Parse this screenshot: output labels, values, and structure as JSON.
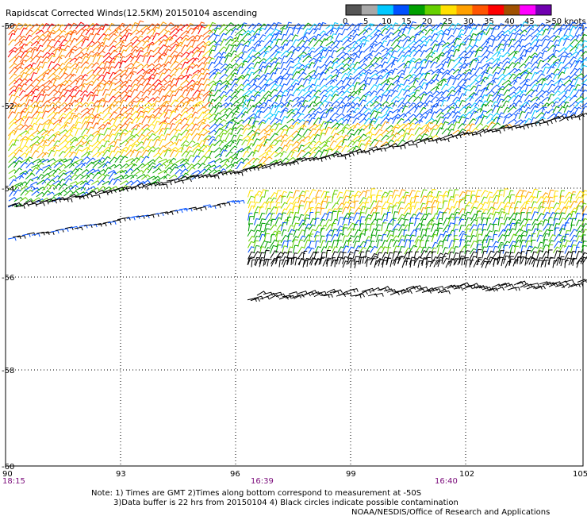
{
  "title": "Rapidscat Corrected Winds(12.5KM) 20150104 ascending",
  "colorbar": {
    "labels": [
      "0",
      "5",
      "10",
      "15",
      "20",
      "25",
      "30",
      "35",
      "40",
      "45",
      ">50 knots"
    ],
    "colors": [
      "#555555",
      "#a8a8a8",
      "#00c8ff",
      "#0050ff",
      "#00a000",
      "#66d000",
      "#ffe000",
      "#ffa000",
      "#ff5500",
      "#ff0000",
      "#a05000",
      "#ff00ff",
      "#7000b0"
    ]
  },
  "map": {
    "lat_labels": [
      "-50",
      "-52",
      "-54",
      "-56",
      "-58",
      "-60"
    ],
    "lon_labels": [
      "90",
      "93",
      "96",
      "99",
      "102",
      "105"
    ],
    "times": [
      "18:15",
      "16:39",
      "16:40"
    ]
  },
  "notes": {
    "line1": "Note: 1) Times are GMT 2)Times along bottom correspond to measurement at -50S",
    "line2": "3)Data buffer is 22 hrs from 20150104 4) Black circles indicate possible contamination",
    "credit": "NOAA/NESDIS/Office of Research and Applications"
  }
}
